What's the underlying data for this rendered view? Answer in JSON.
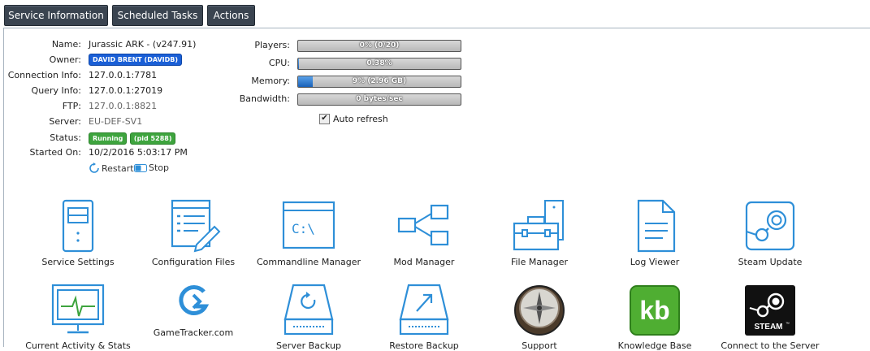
{
  "tabs": [
    {
      "label": "Service Information"
    },
    {
      "label": "Scheduled Tasks"
    },
    {
      "label": "Actions"
    }
  ],
  "info": {
    "name_label": "Name:",
    "name": "Jurassic ARK - (v247.91)",
    "owner_label": "Owner:",
    "owner": "DAVID BRENT (DAVIDB)",
    "connection_label": "Connection Info:",
    "connection": "127.0.0.1:7781",
    "query_label": "Query Info:",
    "query": "127.0.0.1:27019",
    "ftp_label": "FTP:",
    "ftp": "127.0.0.1:8821",
    "server_label": "Server:",
    "server": "EU-DEF-SV1",
    "status_label": "Status:",
    "status": "Running",
    "pid": "(pid 5288)",
    "started_label": "Started On:",
    "started": "10/2/2016 5:03:17 PM"
  },
  "controls": {
    "restart": "Restart",
    "stop": "Stop"
  },
  "meters": [
    {
      "label": "Players:",
      "text": "0% (0/20)",
      "fraction": 0.0
    },
    {
      "label": "CPU:",
      "text": "0.38%",
      "fraction": 0.0038
    },
    {
      "label": "Memory:",
      "text": "9% (2.96 GB)",
      "fraction": 0.09
    },
    {
      "label": "Bandwidth:",
      "text": "0 bytes/sec",
      "fraction": 0.0
    }
  ],
  "auto_refresh": {
    "label": "Auto refresh",
    "checked": true
  },
  "tiles_row1": [
    {
      "label": "Service Settings",
      "icon": "server-tower-icon"
    },
    {
      "label": "Configuration Files",
      "icon": "config-file-pencil-icon"
    },
    {
      "label": "Commandline Manager",
      "icon": "terminal-window-icon"
    },
    {
      "label": "Mod Manager",
      "icon": "share-nodes-icon"
    },
    {
      "label": "File Manager",
      "icon": "briefcase-files-icon"
    },
    {
      "label": "Log Viewer",
      "icon": "document-icon"
    },
    {
      "label": "Steam Update",
      "icon": "steam-logo-icon"
    }
  ],
  "tiles_row2": [
    {
      "label": "Current Activity & Stats",
      "icon": "monitor-pulse-icon"
    },
    {
      "label": "GameTracker.com",
      "icon": "gametracker-logo-icon"
    },
    {
      "label": "Server Backup",
      "icon": "drive-refresh-icon"
    },
    {
      "label": "Restore Backup",
      "icon": "drive-arrow-icon"
    },
    {
      "label": "Support",
      "icon": "compass-icon"
    },
    {
      "label": "Knowledge Base",
      "icon": "kb-logo-icon"
    },
    {
      "label": "Connect to the Server",
      "icon": "steam-connect-icon"
    }
  ],
  "logo_text": {
    "kb": "kb",
    "steam": "STEAM",
    "steam_tm": "™",
    "cmd": "C:\\"
  },
  "colors": {
    "icon_blue": "#2e8fd8",
    "tab_bg": "#3a4450",
    "badge_blue": "#1a5fd6",
    "badge_green": "#3ea43e"
  }
}
